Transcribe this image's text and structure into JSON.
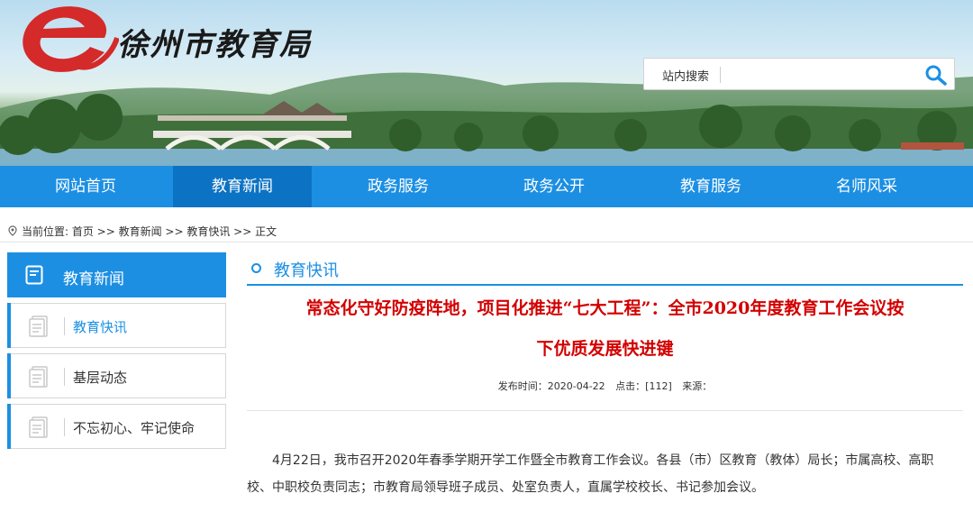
{
  "site": {
    "logo_letter": "e",
    "name": "徐州市教育局"
  },
  "search": {
    "label": "站内搜索",
    "placeholder": ""
  },
  "nav": {
    "items": [
      {
        "label": "网站首页"
      },
      {
        "label": "教育新闻"
      },
      {
        "label": "政务服务"
      },
      {
        "label": "政务公开"
      },
      {
        "label": "教育服务"
      },
      {
        "label": "名师风采"
      }
    ],
    "active_index": 1
  },
  "breadcrumb": {
    "text": "当前位置: 首页 >> 教育新闻 >> 教育快讯 >> 正文"
  },
  "sidebar": {
    "title": "教育新闻",
    "items": [
      {
        "label": "教育快讯",
        "active": true
      },
      {
        "label": "基层动态",
        "active": false
      },
      {
        "label": "不忘初心、牢记使命",
        "active": false
      }
    ]
  },
  "article": {
    "section": "教育快讯",
    "title_line1": "常态化守好防疫阵地，项目化推进“七大工程”：全市2020年度教育工作会议按",
    "title_line2": "下优质发展快进键",
    "publish_label": "发布时间：2020-04-22",
    "clicks_label": "点击：[112]",
    "source_label": "来源：",
    "paragraph": "4月22日，我市召开2020年春季学期开学工作暨全市教育工作会议。各县（市）区教育（教体）局长；市属高校、高职校、中职校负责同志；市教育局领导班子成员、处室负责人，直属学校校长、书记参加会议。"
  },
  "colors": {
    "nav_blue": "#1c8fe3",
    "nav_active": "#0c73c4",
    "headline_red": "#d20000",
    "logo_red": "#d42a2a"
  },
  "icons": [
    "logo-e-icon",
    "search-icon",
    "location-pin-icon",
    "news-doc-icon",
    "list-doc-icon"
  ]
}
